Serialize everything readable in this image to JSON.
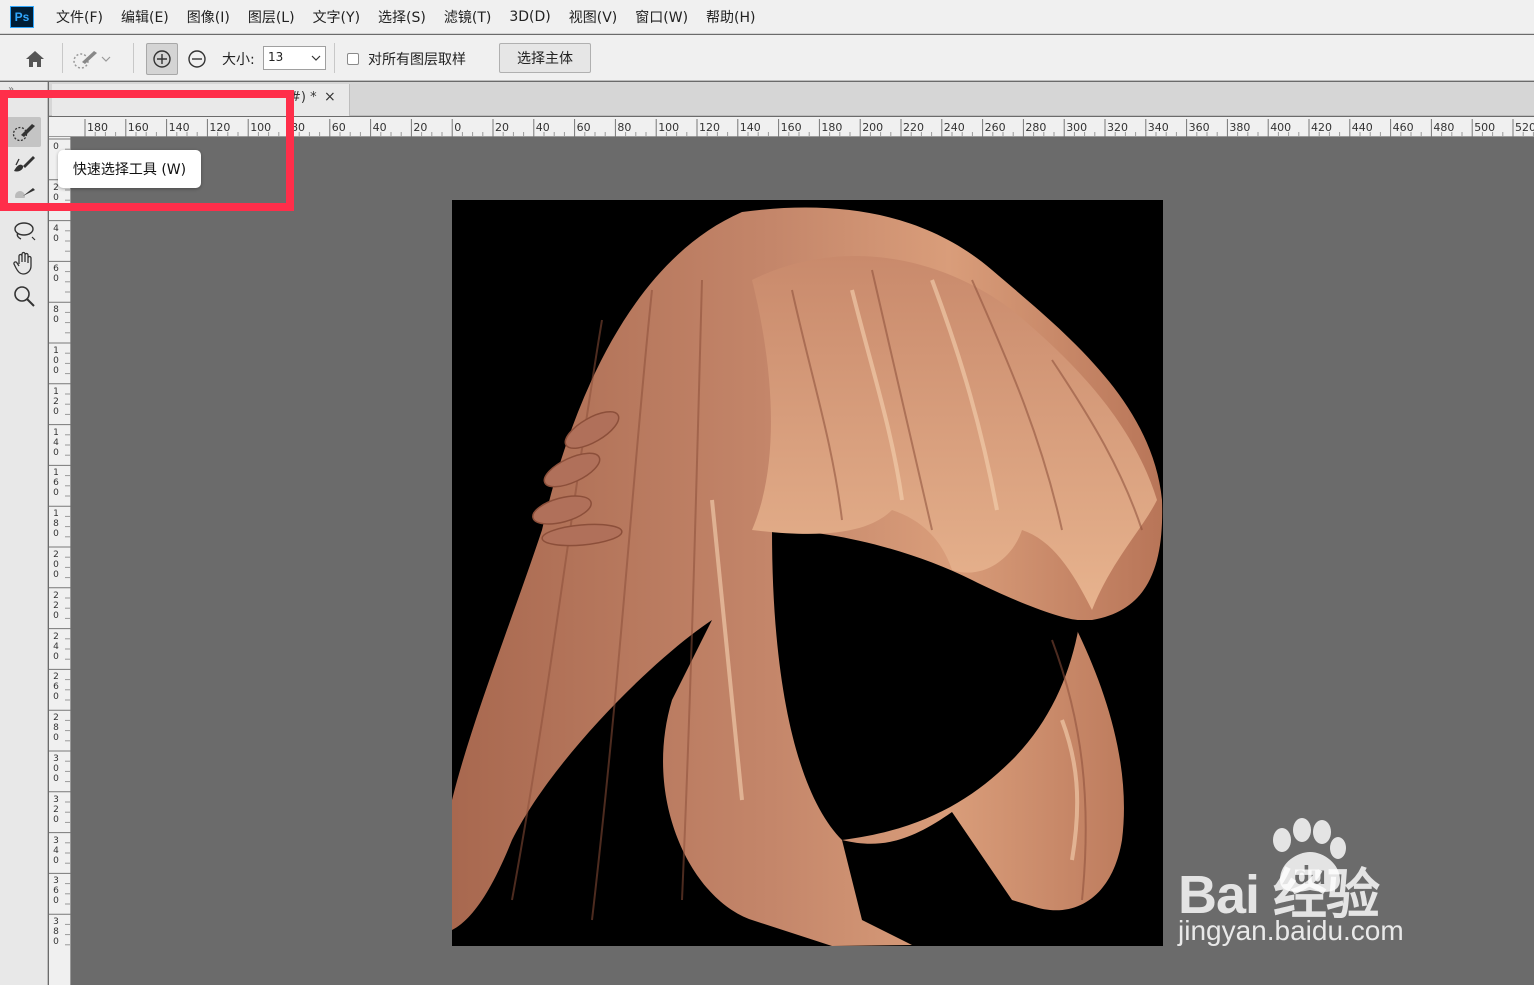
{
  "app": {
    "logo_text": "Ps"
  },
  "menu": [
    "文件(F)",
    "编辑(E)",
    "图像(I)",
    "图层(L)",
    "文字(Y)",
    "选择(S)",
    "滤镜(T)",
    "3D(D)",
    "视图(V)",
    "窗口(W)",
    "帮助(H)"
  ],
  "options": {
    "size_label": "大小:",
    "size_value": "13",
    "sample_all_label": "对所有图层取样",
    "sample_all_checked": false,
    "select_subject_label": "选择主体"
  },
  "tab": {
    "title": "#) *",
    "close": "×"
  },
  "ruler": {
    "top_labels": [
      "180",
      "160",
      "140",
      "120",
      "100",
      "80",
      "60",
      "40",
      "20",
      "0",
      "20",
      "40",
      "60",
      "80",
      "100",
      "120",
      "140",
      "160",
      "180",
      "200",
      "220",
      "240",
      "260",
      "280",
      "300",
      "320",
      "340",
      "360",
      "380",
      "400",
      "420",
      "440",
      "460",
      "480",
      "500",
      "520"
    ],
    "left_labels": [
      "0",
      "2",
      "4",
      "6",
      "8",
      "10",
      "12",
      "14",
      "16",
      "18",
      "20",
      "22",
      "24",
      "26",
      "28",
      "30",
      "32",
      "34",
      "36",
      "38"
    ]
  },
  "tooltip": "快速选择工具 (W)",
  "tools": [
    {
      "name": "quick-selection-tool-icon",
      "active": true
    },
    {
      "name": "magic-wand-brush-icon",
      "active": false
    },
    {
      "name": "lasso-tool-icon",
      "active": false
    },
    {
      "name": "hand-tool-icon",
      "active": false
    },
    {
      "name": "zoom-tool-icon",
      "active": false
    }
  ],
  "colors": {
    "highlight": "#ff2e4a",
    "hair_base": "#b9765a",
    "hair_light": "#e8b48e"
  },
  "watermark": {
    "brand": "Bai  经验",
    "url": "jingyan.baidu.com"
  }
}
